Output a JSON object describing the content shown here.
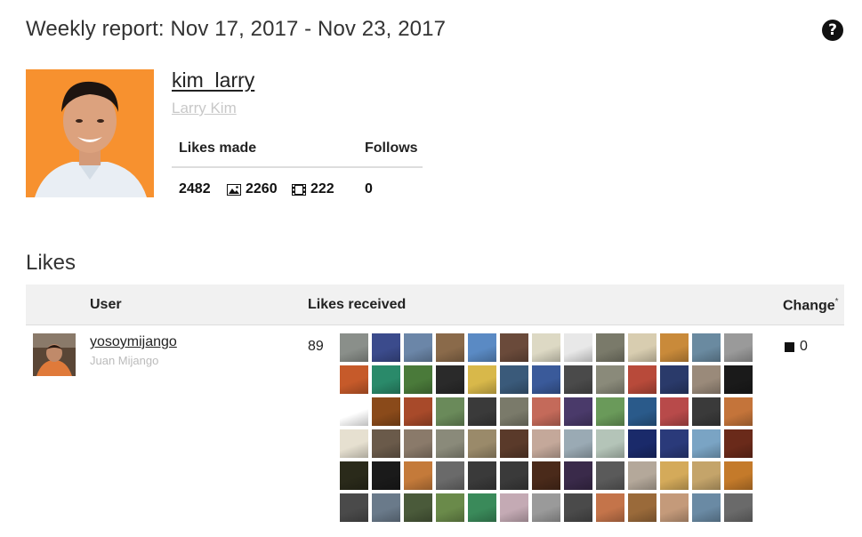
{
  "header": {
    "title": "Weekly report: Nov 17, 2017 - Nov 23, 2017",
    "help_icon": "question-circle-icon"
  },
  "profile": {
    "username": "kim_larry",
    "full_name": "Larry Kim",
    "stats_headers": {
      "likes_made": "Likes made",
      "follows": "Follows"
    },
    "stats": {
      "likes_made": "2482",
      "photos": "2260",
      "videos": "222",
      "follows": "0"
    },
    "icons": {
      "photos": "image-icon",
      "videos": "film-icon"
    },
    "photo_bg": "#f7912f"
  },
  "likes_section": {
    "title": "Likes",
    "columns": {
      "user": "User",
      "likes_received": "Likes received",
      "change": "Change",
      "change_marker": "*"
    },
    "rows": [
      {
        "username": "yosoymijango",
        "full_name": "Juan Mijango",
        "likes_received": "89",
        "change": "0",
        "change_icon": "square-icon"
      }
    ]
  },
  "thumbnail_colors": [
    "#8a8f8a",
    "#3b4b8c",
    "#6b86a8",
    "#8a6a4a",
    "#5a8ac4",
    "#6a4a3a",
    "#ddd9c4",
    "#e8e8e8",
    "#7a7a6a",
    "#d8cdb0",
    "#c98a3a",
    "#6a8aa0",
    "#9a9a9a",
    "#c65a2a",
    "#2a8a6a",
    "#4a7a3a",
    "#2a2a2a",
    "#d8b84a",
    "#3a5a7a",
    "#3a5a9a",
    "#4a4a4a",
    "#8a8a7a",
    "#b84a3a",
    "#2a3a6a",
    "#9a8a7a",
    "#1a1a1a",
    "#ffffff",
    "#8a4a1a",
    "#a84a2a",
    "#6a8a5a",
    "#3a3a3a",
    "#7a7a6a",
    "#c46a5a",
    "#4a3a6a",
    "#6a9a5a",
    "#2a5a8a",
    "#b84a4a",
    "#3a3a3a",
    "#c4743a",
    "#e6e0d0",
    "#6a5a4a",
    "#8a7a6a",
    "#8a8a7a",
    "#9a8a6a",
    "#5a3a2a",
    "#c4a89a",
    "#9aaab4",
    "#b4c4b8",
    "#1a2a6a",
    "#2a3a7a",
    "#7aa4c4",
    "#6a2a1a",
    "#2a2a1a",
    "#1a1a1a",
    "#c47a3a",
    "#6a6a6a",
    "#3a3a3a",
    "#3a3a3a",
    "#4a2a1a",
    "#3a2a4a",
    "#5a5a5a",
    "#b4a89a",
    "#d4aa5a",
    "#c4a46a",
    "#c47a2a",
    "#4a4a4a",
    "#6a7a8a",
    "#4a5a3a",
    "#6a8a4a",
    "#3a8a5a",
    "#c4aab4",
    "#9a9a9a",
    "#4a4a4a",
    "#c4744a",
    "#9a6a3a",
    "#c49a7a",
    "#6a8aa4",
    "#6a6a6a"
  ]
}
